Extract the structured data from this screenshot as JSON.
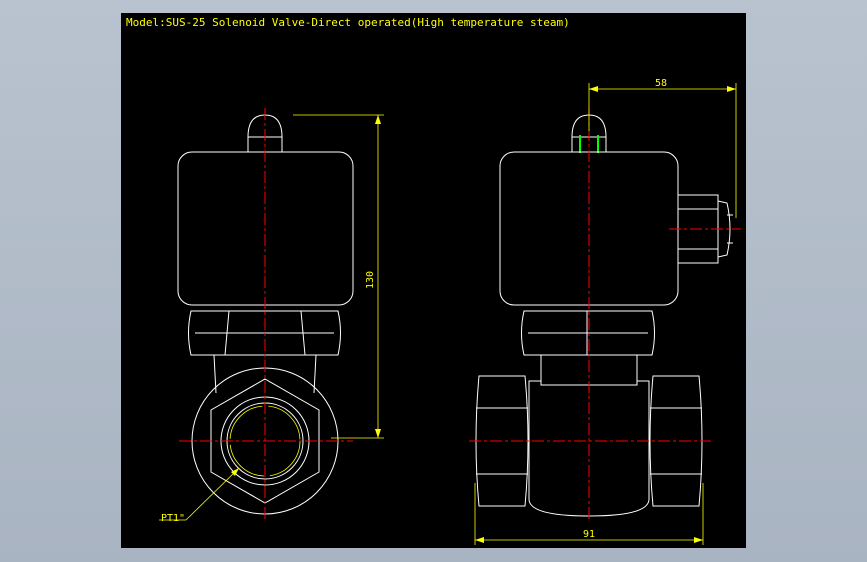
{
  "title": "Model:SUS-25 Solenoid Valve-Direct operated(High temperature steam)",
  "dimensions": {
    "height": "130",
    "terminal_offset": "58",
    "body_width": "91",
    "thread": "PT1\""
  },
  "colors": {
    "background": "#000000",
    "outline": "#ffffff",
    "dimension": "#ffff00",
    "centerline": "#ff0000",
    "accent": "#00ff00"
  }
}
